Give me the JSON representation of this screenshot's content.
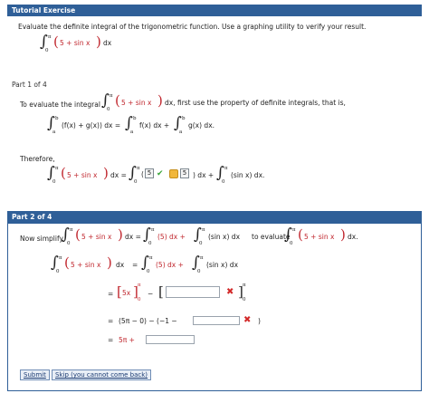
{
  "tutorial": {
    "header": "Tutorial Exercise",
    "prompt": "Evaluate the definite integral of the trigonometric function. Use a graphing utility to verify your result."
  },
  "integrand": {
    "lower": "0",
    "upper": "π",
    "body": "5 + sin x",
    "dx": "dx"
  },
  "part1": {
    "label": "Part 1 of 4",
    "intro": "To evaluate the integral",
    "after": ", first use the property of definite integrals, that is,",
    "property_left": "(f(x) + g(x)) dx =",
    "property_f": "f(x) dx +",
    "property_g": "g(x) dx.",
    "lim_a": "a",
    "lim_b": "b",
    "therefore": "Therefore,",
    "answer1": "5",
    "answer2": "5",
    "dx_plus": ") dx +",
    "sin_term": "(sin x) dx."
  },
  "part2": {
    "header": "Part 2 of 4",
    "now_simplify": "Now simplify",
    "five_dx": "(5) dx +",
    "sin_dx": "(sin x) dx",
    "to_evaluate": "to evaluate",
    "period": "dx.",
    "five_x": "5x",
    "minus": "−",
    "row3": "(5π − 0) − (−1 −",
    "row3_end": ")",
    "row4": "5π +",
    "eq": "="
  },
  "buttons": {
    "submit": "Submit",
    "skip": "Skip (you cannot come back)"
  }
}
